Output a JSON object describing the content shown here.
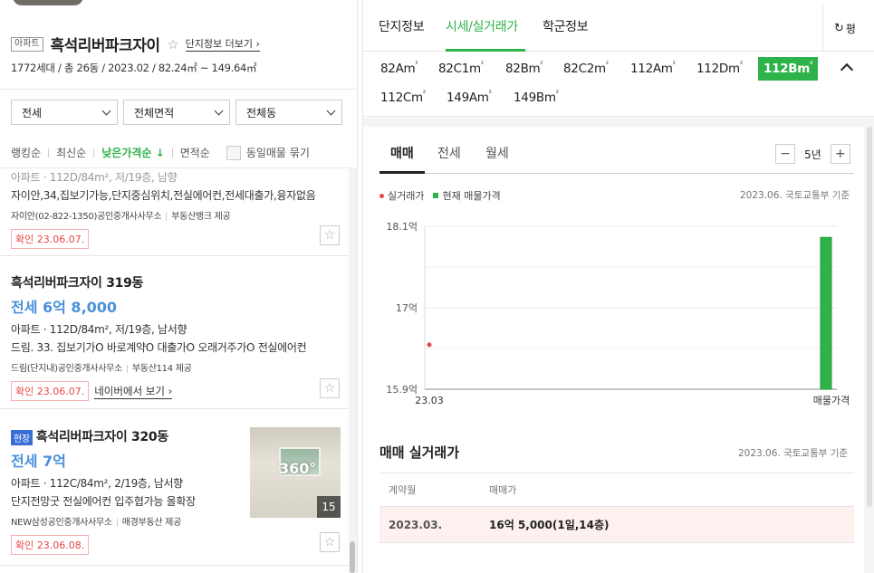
{
  "complex": {
    "type_tag": "아파트",
    "title": "흑석리버파크자이",
    "more_label": "단지정보 더보기",
    "summary": "1772세대 / 총 26동 / 2023.02 / 82.24㎡ ~ 149.64㎡"
  },
  "filters": [
    {
      "label": "전세"
    },
    {
      "label": "전체면적"
    },
    {
      "label": "전체동"
    }
  ],
  "sort": {
    "items": [
      "랭킹순",
      "최신순",
      "낮은가격순 ↓",
      "면적순"
    ],
    "active_index": 2,
    "same_listing_label": "동일매물 묶기"
  },
  "listings": [
    {
      "partial_spec": "아파트 · 112D/84m², 저/19층, 남향",
      "desc": "자이안,34,집보기가능,단지중심위치,전실에어컨,전세대출가,융자없음",
      "agent": "자이안(02-822-1350)공인중개사사무소",
      "provider": "부동산뱅크 제공",
      "confirm": "확인 23.06.07."
    },
    {
      "title": "흑석리버파크자이 319동",
      "price": "전세 6억 8,000",
      "spec": "아파트 · 112D/84m², 저/19층, 남서향",
      "desc": "드림. 33. 집보기가O 바로계약O 대출가O 오래거주가O 전실에어컨",
      "agent": "드림(단지내)공인중개사사무소",
      "provider": "부동산114 제공",
      "confirm": "확인 23.06.07.",
      "naver_label": "네이버에서 보기"
    },
    {
      "live_tag": "현장",
      "title": "흑석리버파크자이 320동",
      "price": "전세 7억",
      "spec": "아파트 · 112C/84m², 2/19층, 남서향",
      "desc": "단지전망굿 전실에어컨 입주협가능 올확장",
      "agent": "NEW삼성공인중개사사무소",
      "provider": "매경부동산 제공",
      "confirm": "확인 23.06.08.",
      "photo_badge": "360°",
      "photo_count": "15"
    }
  ],
  "right": {
    "tabs": [
      "단지정보",
      "시세/실거래가",
      "학군정보"
    ],
    "active_tab": 1,
    "unit_label": "평",
    "areas": [
      {
        "label": "82Am",
        "sup": "²"
      },
      {
        "label": "82C1m",
        "sup": "²"
      },
      {
        "label": "82Bm",
        "sup": "²"
      },
      {
        "label": "82C2m",
        "sup": "²"
      },
      {
        "label": "112Am",
        "sup": "²"
      },
      {
        "label": "112Dm",
        "sup": "²"
      },
      {
        "label": "112Bm",
        "sup": "²"
      },
      {
        "label": "112Cm",
        "sup": "²"
      },
      {
        "label": "149Am",
        "sup": "²"
      },
      {
        "label": "149Bm",
        "sup": "²"
      }
    ],
    "active_area": 6,
    "sub_tabs": [
      "매매",
      "전세",
      "월세"
    ],
    "period_label": "5년",
    "legend": {
      "actual": "실거래가",
      "current": "현재 매물가격",
      "source": "2023.06. 국토교통부 기준"
    },
    "deals": {
      "title": "매매 실거래가",
      "source": "2023.06. 국토교통부 기준",
      "headers": [
        "계약월",
        "매매가"
      ],
      "rows": [
        {
          "month": "2023.03.",
          "price": "16억 5,000(1일,14층)"
        }
      ]
    }
  },
  "colors": {
    "accent_green": "#2eb24a",
    "price_blue": "#4a90d9",
    "confirm_red": "#e84848",
    "live_tag_blue": "#3a6fd8"
  },
  "chart_data": {
    "type": "scatter",
    "ytick_labels": [
      "18.1억",
      "17억",
      "15.9억"
    ],
    "yticks": [
      18.1,
      17.0,
      15.9
    ],
    "ylim": [
      15.9,
      18.1
    ],
    "xtick_labels": [
      "23.03",
      "매물가격"
    ],
    "series": [
      {
        "name": "실거래가",
        "type": "scatter",
        "color": "#e84848",
        "points": [
          {
            "x": "23.03",
            "y": 16.5
          }
        ]
      },
      {
        "name": "현재 매물가격",
        "type": "bar",
        "color": "#2eb24a",
        "range": [
          15.9,
          17.95
        ]
      }
    ]
  }
}
